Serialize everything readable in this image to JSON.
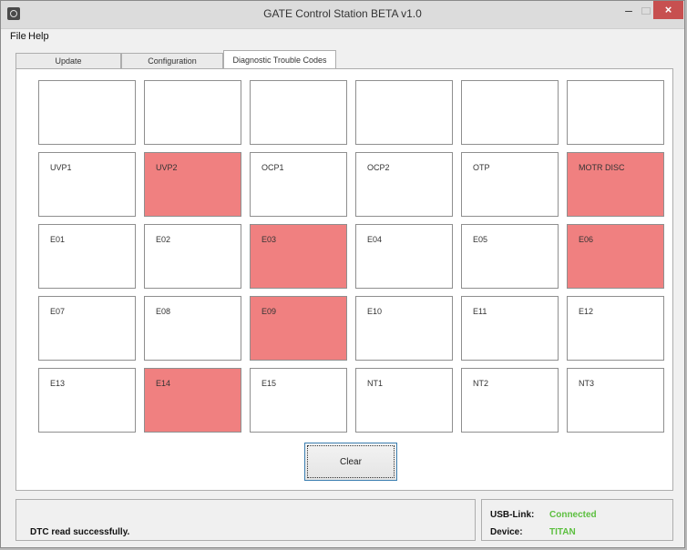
{
  "window": {
    "title": "GATE Control Station BETA v1.0"
  },
  "menu": {
    "items": [
      "File",
      "Help"
    ]
  },
  "tabs": [
    "Update",
    "Configuration",
    "Diagnostic Trouble Codes"
  ],
  "grid": {
    "rows": [
      [
        {
          "label": "",
          "active": false
        },
        {
          "label": "",
          "active": false
        },
        {
          "label": "",
          "active": false
        },
        {
          "label": "",
          "active": false
        },
        {
          "label": "",
          "active": false
        },
        {
          "label": "",
          "active": false
        }
      ],
      [
        {
          "label": "UVP1",
          "active": false
        },
        {
          "label": "UVP2",
          "active": true
        },
        {
          "label": "OCP1",
          "active": false
        },
        {
          "label": "OCP2",
          "active": false
        },
        {
          "label": "OTP",
          "active": false
        },
        {
          "label": "MOTR DISC",
          "active": true
        }
      ],
      [
        {
          "label": "E01",
          "active": false
        },
        {
          "label": "E02",
          "active": false
        },
        {
          "label": "E03",
          "active": true
        },
        {
          "label": "E04",
          "active": false
        },
        {
          "label": "E05",
          "active": false
        },
        {
          "label": "E06",
          "active": true
        }
      ],
      [
        {
          "label": "E07",
          "active": false
        },
        {
          "label": "E08",
          "active": false
        },
        {
          "label": "E09",
          "active": true
        },
        {
          "label": "E10",
          "active": false
        },
        {
          "label": "E11",
          "active": false
        },
        {
          "label": "E12",
          "active": false
        }
      ],
      [
        {
          "label": "E13",
          "active": false
        },
        {
          "label": "E14",
          "active": true
        },
        {
          "label": "E15",
          "active": false
        },
        {
          "label": "NT1",
          "active": false
        },
        {
          "label": "NT2",
          "active": false
        },
        {
          "label": "NT3",
          "active": false
        }
      ]
    ]
  },
  "clear_button": "Clear",
  "status": {
    "message": "DTC read successfully."
  },
  "link": {
    "usb_label": "USB-Link:",
    "usb_value": "Connected",
    "device_label": "Device:",
    "device_value": "TITAN"
  },
  "colors": {
    "active_cell": "#f08080",
    "status_ok": "#5cbf3f"
  }
}
